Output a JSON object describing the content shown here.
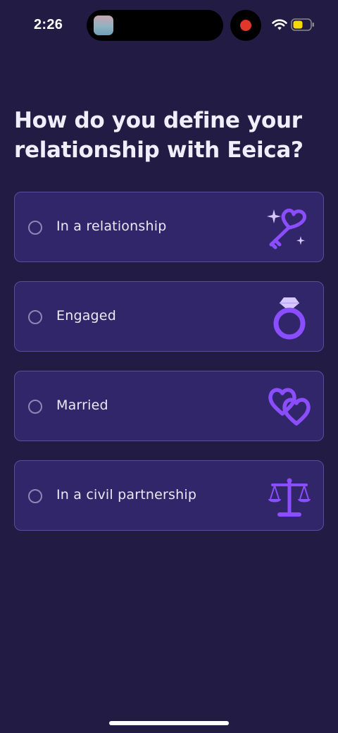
{
  "status_bar": {
    "time": "2:26"
  },
  "question": {
    "title": "How do you define your relationship with Eeica?"
  },
  "options": [
    {
      "label": "In a relationship",
      "icon": "heart-key-icon"
    },
    {
      "label": "Engaged",
      "icon": "ring-icon"
    },
    {
      "label": "Married",
      "icon": "two-hearts-icon"
    },
    {
      "label": "In a civil partnership",
      "icon": "scales-icon"
    }
  ],
  "colors": {
    "background": "#221c45",
    "option_fill": "#32266a",
    "option_border": "#5b4d9b",
    "icon_accent": "#8a4dff",
    "text": "#ebe8f7"
  }
}
